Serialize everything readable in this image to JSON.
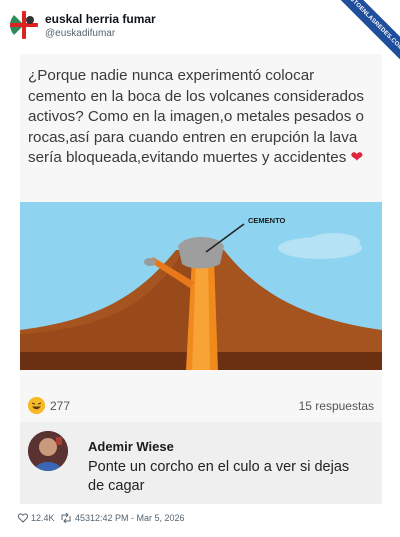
{
  "tweet": {
    "display_name": "euskal herria fumar",
    "handle": "@euskadifumar",
    "ribbon": "VISTOENLASREDES.COM"
  },
  "image": {
    "question": "¿Porque nadie nunca experimentó colocar cemento en la boca de los volcanes considerados activos? Como en la imagen,o metales pesados o rocas,así para cuando entren en erupción la lava sería bloqueada,evitando muertes y accidentes",
    "heart": "❤",
    "diagram_label": "CEMENTO",
    "reactions_count": "277",
    "replies": "15 respuestas",
    "commenter_name": "Ademir Wiese",
    "comment": "Ponte un corcho en el culo a ver si dejas de cagar"
  },
  "footer": {
    "likes": "12.4K",
    "retweets": "453",
    "timestamp": "12:42 PM - Mar 5, 2026"
  }
}
